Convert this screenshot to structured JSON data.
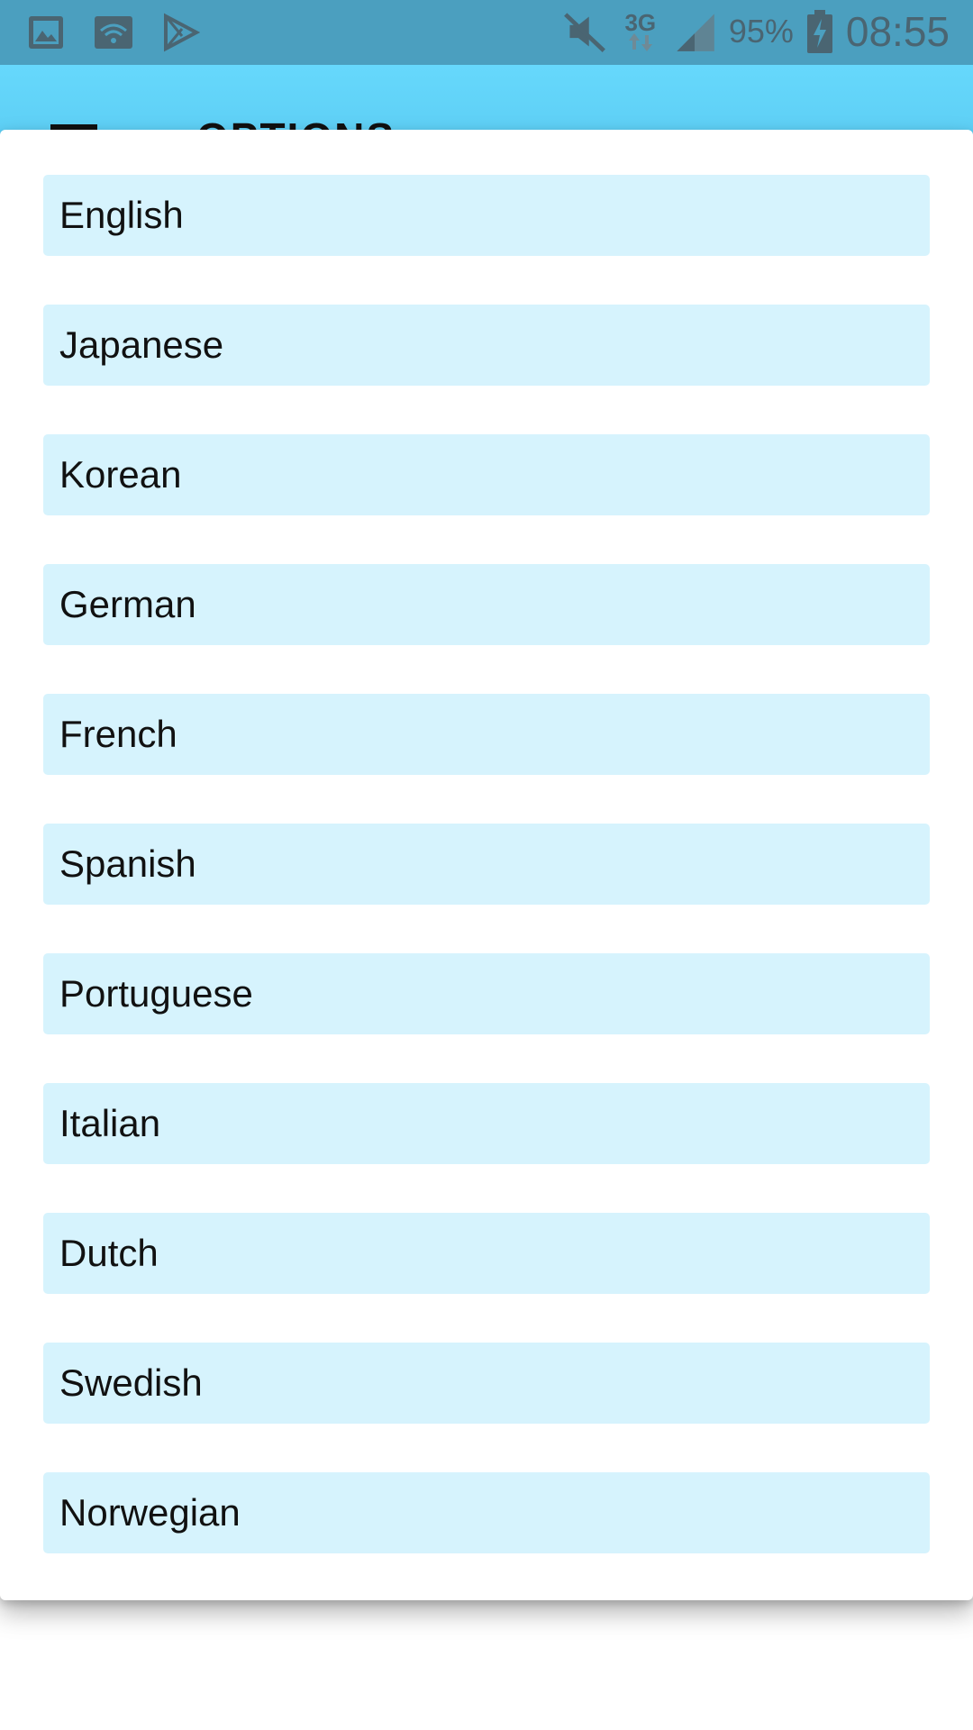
{
  "status_bar": {
    "left_icons": [
      "image-icon",
      "wifi-icon",
      "play-store-icon"
    ],
    "right_icons": [
      "mute-icon",
      "network-3g-icon",
      "signal-icon",
      "battery-charging-icon"
    ],
    "network_type": "3G",
    "battery": "95%",
    "time": "08:55",
    "bg_color": "#4b9fbf"
  },
  "app_bar": {
    "title": "OPTIONS",
    "bg_color": "#66d8fc"
  },
  "languages": [
    "English",
    "Japanese",
    "Korean",
    "German",
    "French",
    "Spanish",
    "Portuguese",
    "Italian",
    "Dutch",
    "Swedish",
    "Norwegian"
  ],
  "colors": {
    "item_bg": "#d6f3fd",
    "dialog_bg": "#ffffff"
  }
}
